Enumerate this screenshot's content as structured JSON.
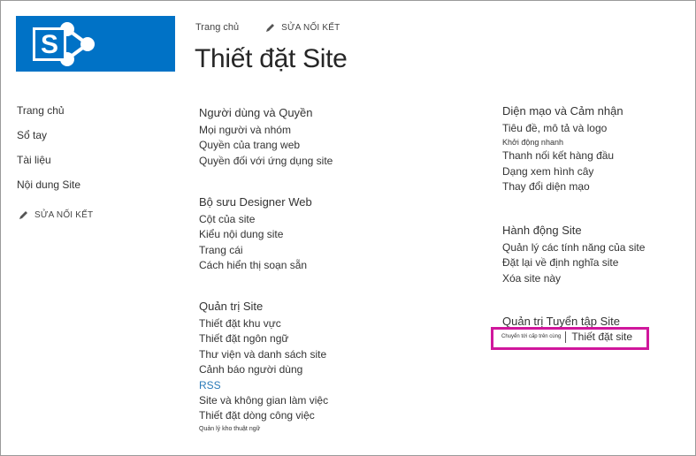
{
  "colors": {
    "brand": "#0072c6",
    "highlight": "#d0179c",
    "link_accent": "#2a7ab8"
  },
  "header": {
    "breadcrumb_home": "Trang chủ",
    "edit_links_label": "SỬA NỐI KẾT",
    "page_title": "Thiết đặt Site"
  },
  "leftnav": {
    "items": [
      "Trang chủ",
      "Sổ tay",
      "Tài liệu",
      "Nội dung Site"
    ],
    "edit_links_label": "SỬA NỐI KẾT"
  },
  "sections": {
    "users": {
      "title": "Người dùng và Quyền",
      "links": [
        "Mọi người và nhóm",
        "Quyền của trang web",
        "Quyền đối với ứng dụng site"
      ]
    },
    "designer": {
      "title": "Bộ sưu Designer Web",
      "links": [
        "Cột của site",
        "Kiểu nội dung site",
        "Trang cái",
        "Cách hiển thị soạn sẵn"
      ]
    },
    "admin": {
      "title": "Quản trị Site",
      "links": [
        "Thiết đặt khu vực",
        "Thiết đặt ngôn ngữ",
        "Thư viện và danh sách site",
        "Cảnh báo người dùng",
        "RSS",
        "Site và không gian làm việc",
        "Thiết đặt dòng công việc",
        "Quản lý kho thuật ngữ"
      ]
    },
    "look": {
      "title": "Diện mạo và Cảm nhận",
      "links": [
        "Tiêu đề, mô tả và logo",
        "Khởi động nhanh",
        "Thanh nối kết hàng đầu",
        "Dạng xem hình cây",
        "Thay đổi diện mạo"
      ]
    },
    "actions": {
      "title": "Hành động Site",
      "links": [
        "Quản lý các tính năng của site",
        "Đặt lại về định nghĩa site",
        "Xóa site này"
      ]
    },
    "collection": {
      "title": "Quản trị Tuyển tập Site",
      "goto_top_label": "Chuyển tới cấp trên cùng",
      "settings_label": "Thiết đặt site"
    }
  }
}
